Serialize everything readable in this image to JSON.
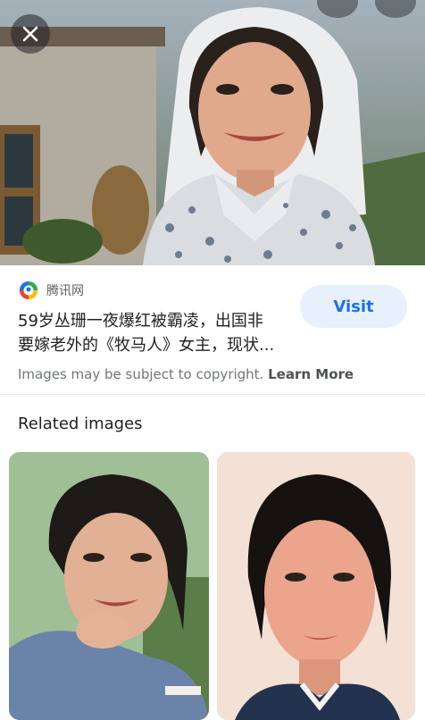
{
  "viewer": {
    "close_icon": "close-icon",
    "top_icons": [
      "lens-icon",
      "more-icon"
    ]
  },
  "result": {
    "source_logo_icon": "tencent-news-logo",
    "source_name": "腾讯网",
    "title_line1": "59岁丛珊一夜爆红被霸凌，出国非",
    "title_line2": "要嫁老外的《牧马人》女主，现状...",
    "visit_label": "Visit",
    "copyright_text": "Images may be subject to copyright.",
    "learn_more_label": "Learn More"
  },
  "related": {
    "heading": "Related images"
  },
  "colors": {
    "accent": "#1a73e8",
    "visit_bg": "#e8f0fe",
    "text_primary": "#202124",
    "text_secondary": "#70757a"
  }
}
